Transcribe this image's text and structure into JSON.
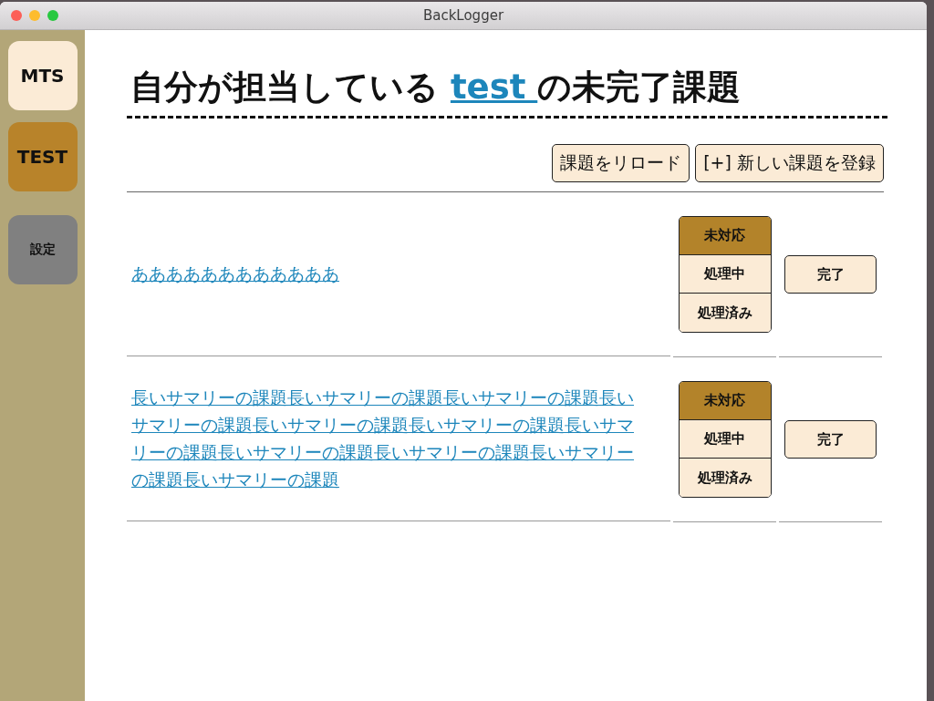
{
  "window": {
    "title": "BackLogger"
  },
  "sidebar": {
    "items": [
      {
        "label": "MTS",
        "kind": "project",
        "selected": false
      },
      {
        "label": "TEST",
        "kind": "project",
        "selected": true
      },
      {
        "label": "設定",
        "kind": "settings"
      }
    ]
  },
  "heading": {
    "prefix": "自分が担当している",
    "project_link": "test",
    "suffix": "の未完了課題"
  },
  "toolbar": {
    "buttons": [
      "課題をリロード",
      "[+] 新しい課題を登録"
    ]
  },
  "issues": [
    {
      "summary": "ああああああああああああ",
      "statuses": [
        {
          "label": "未対応",
          "selected": true
        },
        {
          "label": "処理中",
          "selected": false
        },
        {
          "label": "処理済み",
          "selected": false
        }
      ],
      "done_button": "完了"
    },
    {
      "summary": "長いサマリーの課題長いサマリーの課題長いサマリーの課題長いサマリーの課題長いサマリーの課題長いサマリーの課題長いサマリーの課題長いサマリーの課題長いサマリーの課題長いサマリーの課題長いサマリーの課題",
      "statuses": [
        {
          "label": "未対応",
          "selected": true
        },
        {
          "label": "処理中",
          "selected": false
        },
        {
          "label": "処理済み",
          "selected": false
        }
      ],
      "done_button": "完了"
    }
  ]
}
